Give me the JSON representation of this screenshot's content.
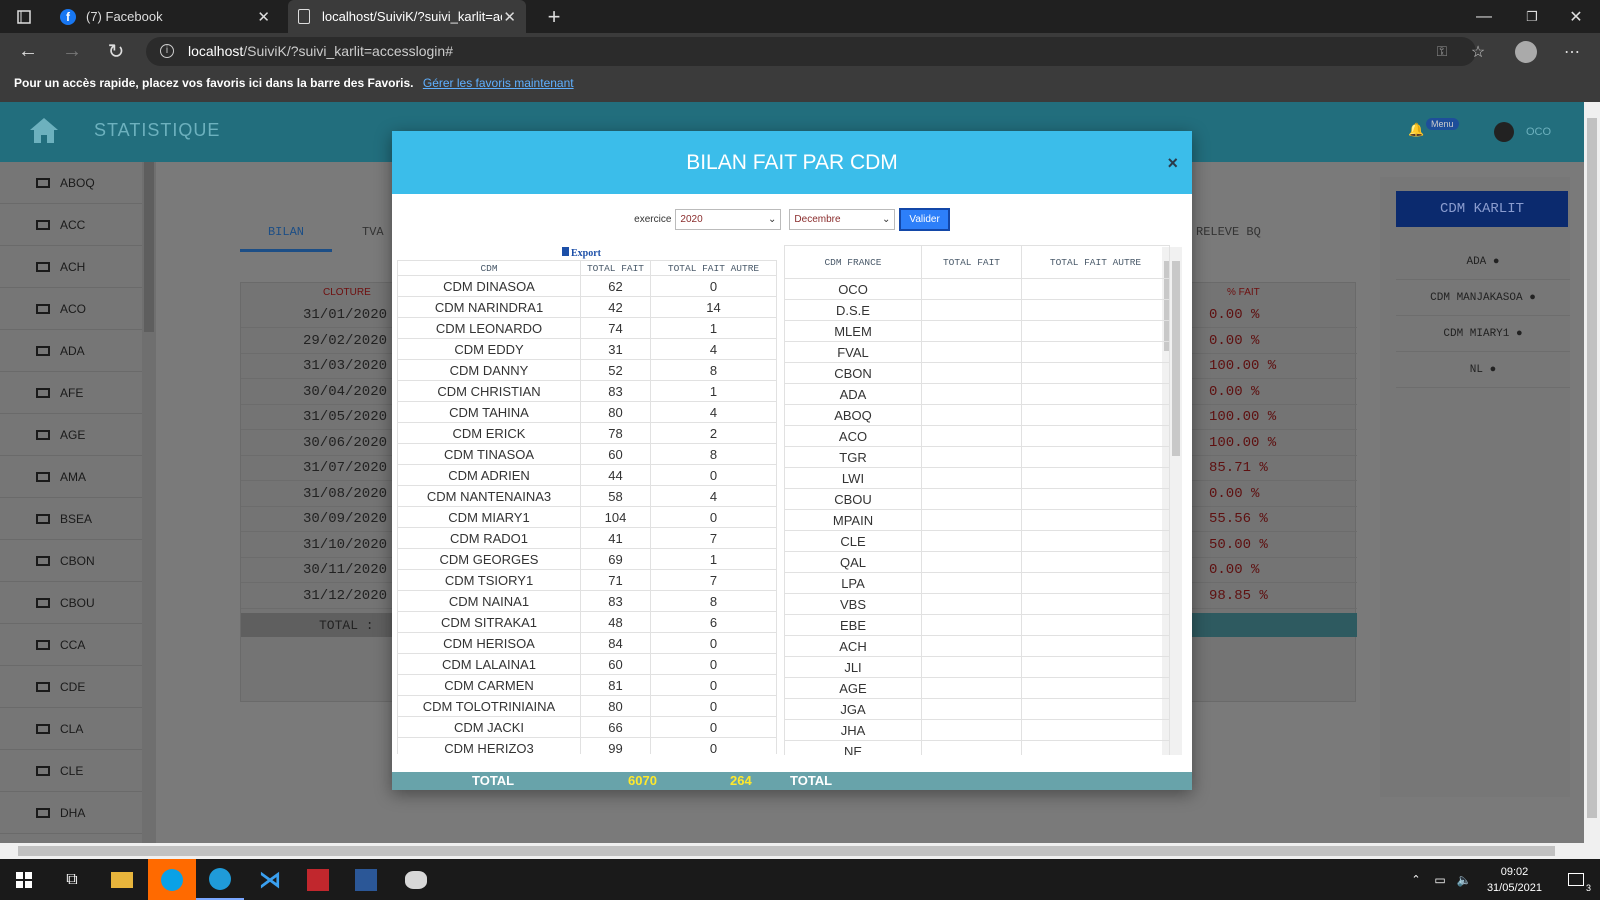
{
  "browser": {
    "tabs": [
      {
        "label": "(7) Facebook"
      },
      {
        "label": "localhost/SuiviK/?suivi_karlit=acc"
      }
    ],
    "url_host": "localhost",
    "url_path": "/SuiviK/?suivi_karlit=accesslogin#",
    "favbar_text": "Pour un accès rapide, placez vos favoris ici dans la barre des Favoris.",
    "favbar_link": "Gérer les favoris maintenant"
  },
  "app": {
    "title": "STATISTIQUE",
    "menu_badge": "Menu",
    "user": "OCO",
    "tabs": [
      "BILAN",
      "TVA",
      "RELEVE BQ"
    ],
    "sidebar": [
      "ABOQ",
      "ACC",
      "ACH",
      "ACO",
      "ADA",
      "AFE",
      "AGE",
      "AMA",
      "BSEA",
      "CBON",
      "CBOU",
      "CCA",
      "CDE",
      "CLA",
      "CLE",
      "DHA"
    ],
    "right_title": "CDM KARLIT",
    "right_items": [
      "ADA",
      "CDM MANJAKASOA",
      "CDM MIARY1",
      "NL"
    ],
    "bg_table": {
      "col_cloture": "CLOTURE",
      "col_pct": "% FAIT",
      "dates": [
        "31/01/2020",
        "29/02/2020",
        "31/03/2020",
        "30/04/2020",
        "31/05/2020",
        "30/06/2020",
        "31/07/2020",
        "31/08/2020",
        "30/09/2020",
        "31/10/2020",
        "30/11/2020",
        "31/12/2020"
      ],
      "pct": [
        "0.00 %",
        "0.00 %",
        "100.00 %",
        "0.00 %",
        "100.00 %",
        "100.00 %",
        "85.71 %",
        "0.00 %",
        "55.56 %",
        "50.00 %",
        "0.00 %",
        "98.85 %"
      ],
      "total_label": "TOTAL :"
    }
  },
  "modal": {
    "title": "BILAN FAIT PAR CDM",
    "close": "×",
    "exercice_label": "exercice",
    "year": "2020",
    "month": "Decembre",
    "validate": "Valider",
    "export": "Export",
    "left_headers": [
      "CDM",
      "TOTAL FAIT",
      "TOTAL FAIT AUTRE"
    ],
    "left_rows": [
      [
        "CDM DINASOA",
        "62",
        "0"
      ],
      [
        "CDM NARINDRA1",
        "42",
        "14"
      ],
      [
        "CDM LEONARDO",
        "74",
        "1"
      ],
      [
        "CDM EDDY",
        "31",
        "4"
      ],
      [
        "CDM DANNY",
        "52",
        "8"
      ],
      [
        "CDM CHRISTIAN",
        "83",
        "1"
      ],
      [
        "CDM TAHINA",
        "80",
        "4"
      ],
      [
        "CDM ERICK",
        "78",
        "2"
      ],
      [
        "CDM TINASOA",
        "60",
        "8"
      ],
      [
        "CDM ADRIEN",
        "44",
        "0"
      ],
      [
        "CDM NANTENAINA3",
        "58",
        "4"
      ],
      [
        "CDM MIARY1",
        "104",
        "0"
      ],
      [
        "CDM RADO1",
        "41",
        "7"
      ],
      [
        "CDM GEORGES",
        "69",
        "1"
      ],
      [
        "CDM TSIORY1",
        "71",
        "7"
      ],
      [
        "CDM NAINA1",
        "83",
        "8"
      ],
      [
        "CDM SITRAKA1",
        "48",
        "6"
      ],
      [
        "CDM HERISOA",
        "84",
        "0"
      ],
      [
        "CDM LALAINA1",
        "60",
        "0"
      ],
      [
        "CDM CARMEN",
        "81",
        "0"
      ],
      [
        "CDM TOLOTRINIAINA",
        "80",
        "0"
      ],
      [
        "CDM JACKI",
        "66",
        "0"
      ],
      [
        "CDM HERIZO3",
        "99",
        "0"
      ]
    ],
    "right_headers": [
      "CDM FRANCE",
      "TOTAL FAIT",
      "TOTAL FAIT AUTRE"
    ],
    "right_rows": [
      "OCO",
      "D.S.E",
      "MLEM",
      "FVAL",
      "CBON",
      "ADA",
      "ABOQ",
      "ACO",
      "TGR",
      "LWI",
      "CBOU",
      "MPAIN",
      "CLE",
      "QAL",
      "LPA",
      "VBS",
      "EBE",
      "ACH",
      "JLI",
      "AGE",
      "JGA",
      "JHA",
      "NE"
    ],
    "footer": {
      "total_label": "TOTAL",
      "total_fait": "6070",
      "total_autre": "264",
      "total_right": "TOTAL"
    }
  },
  "taskbar": {
    "time": "09:02",
    "date": "31/05/2021",
    "notif": "3"
  }
}
